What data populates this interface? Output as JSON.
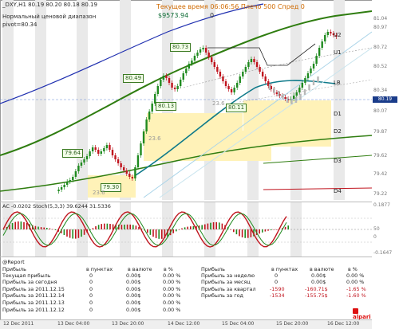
{
  "header": {
    "symbol_line": "_DXY,H1  80.19 80.20 80.18 80.19",
    "indicator_line1": "Нормальный ценовой диапазон",
    "indicator_line2": "pivot=80.34",
    "time_remaining": "Текущее время 06:06:56 Плечо 500 Спред 0",
    "balance": "$9573.94",
    "zero_value": "0"
  },
  "price_boxes": [
    "80.73",
    "80.49",
    "80.13",
    "80.11",
    "79.64",
    "79.30",
    "23.6",
    "23.6",
    "23.6"
  ],
  "levels": [
    "U2",
    "U1",
    "LB",
    "D1",
    "D2",
    "D3",
    "D4"
  ],
  "price_axis": [
    "81.04",
    "80.97",
    "80.72",
    "80.52",
    "80.34",
    "80.19",
    "80.07",
    "79.87",
    "79.62",
    "79.42",
    "79.22"
  ],
  "current_price": "80.19",
  "indicator": {
    "label": "AC -0.0202  Stoch(5,3,3) 39.6244 31.5336",
    "axis": [
      "0.1877",
      "50",
      "0",
      "-0.1647"
    ]
  },
  "report": {
    "title": "@Report",
    "left_headers": [
      "Прибыль",
      "в пунктах",
      "в валюте",
      "в %"
    ],
    "left_rows": [
      [
        "Текущая прибыль",
        "0",
        "0.00$",
        "0.00 %"
      ],
      [
        "Прибыль за сегодня",
        "0",
        "0.00$",
        "0.00 %"
      ],
      [
        "Прибыль за 2011.12.15",
        "0",
        "0.00$",
        "0.00 %"
      ],
      [
        "Прибыль за 2011.12.14",
        "0",
        "0.00$",
        "0.00 %"
      ],
      [
        "Прибыль за 2011.12.13",
        "0",
        "0.00$",
        "0.00 %"
      ],
      [
        "Прибыль за 2011.12.12",
        "0",
        "0.00$",
        "0.00 %"
      ]
    ],
    "right_headers": [
      "Прибыль",
      "в пунктах",
      "в валюте",
      "в %"
    ],
    "right_rows": [
      [
        "Прибыль за неделю",
        "0",
        "0.00$",
        "0.00 %"
      ],
      [
        "Прибыль за месяц",
        "0",
        "0.00$",
        "0.00 %"
      ],
      [
        "Прибыль за квартал",
        "-1590",
        "-160.71$",
        "-1.65 %"
      ],
      [
        "Прибыль за год",
        "-1534",
        "-155.75$",
        "-1.60 %"
      ]
    ]
  },
  "brand": "alpari",
  "time_axis": [
    "12 Dec 2011",
    "13 Dec 04:00",
    "13 Dec 20:00",
    "14 Dec 12:00",
    "15 Dec 04:00",
    "15 Dec 20:00",
    "16 Dec 12:00"
  ],
  "colors": {
    "bull": "#1f8a1f",
    "bear": "#c0141e",
    "channel_green": "#2f7d10",
    "channel_blue": "#2030b0",
    "zone": "#fff2b8",
    "price_badge": "#1a3c8a"
  }
}
